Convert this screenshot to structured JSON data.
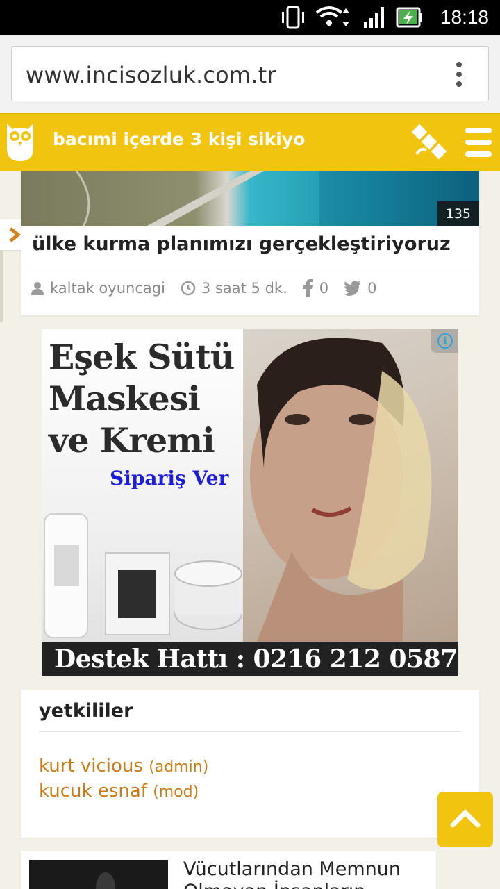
{
  "status_bar": {
    "time": "18:18"
  },
  "browser": {
    "url": "www.incisozluk.com.tr"
  },
  "header": {
    "title": "bacımi içerde 3 kişi sikiyo"
  },
  "article": {
    "views": "135",
    "title": "ülke kurma planımızı gerçekleştiriyoruz",
    "author": "kaltak oyuncagi",
    "time": "3 saat 5 dk.",
    "facebook_count": "0",
    "twitter_count": "0"
  },
  "ad": {
    "headline_1": "Eşek Sütü",
    "headline_2": "Maskesi",
    "headline_3": "ve Kremi",
    "cta": "Sipariş Ver",
    "support": "Destek Hattı : 0216 212 0587",
    "info_icon": "i"
  },
  "authorities": {
    "title": "yetkililer",
    "items": [
      {
        "name": "kurt vicious",
        "role": "(admin)"
      },
      {
        "name": "kucuk esnaf",
        "role": "(mod)"
      }
    ]
  },
  "related": {
    "title": "Vücutlarından Memnun Olmayan İnsanların"
  },
  "colors": {
    "brand": "#f1c40f",
    "link": "#c87d1a",
    "cta": "#1d1fd6"
  }
}
